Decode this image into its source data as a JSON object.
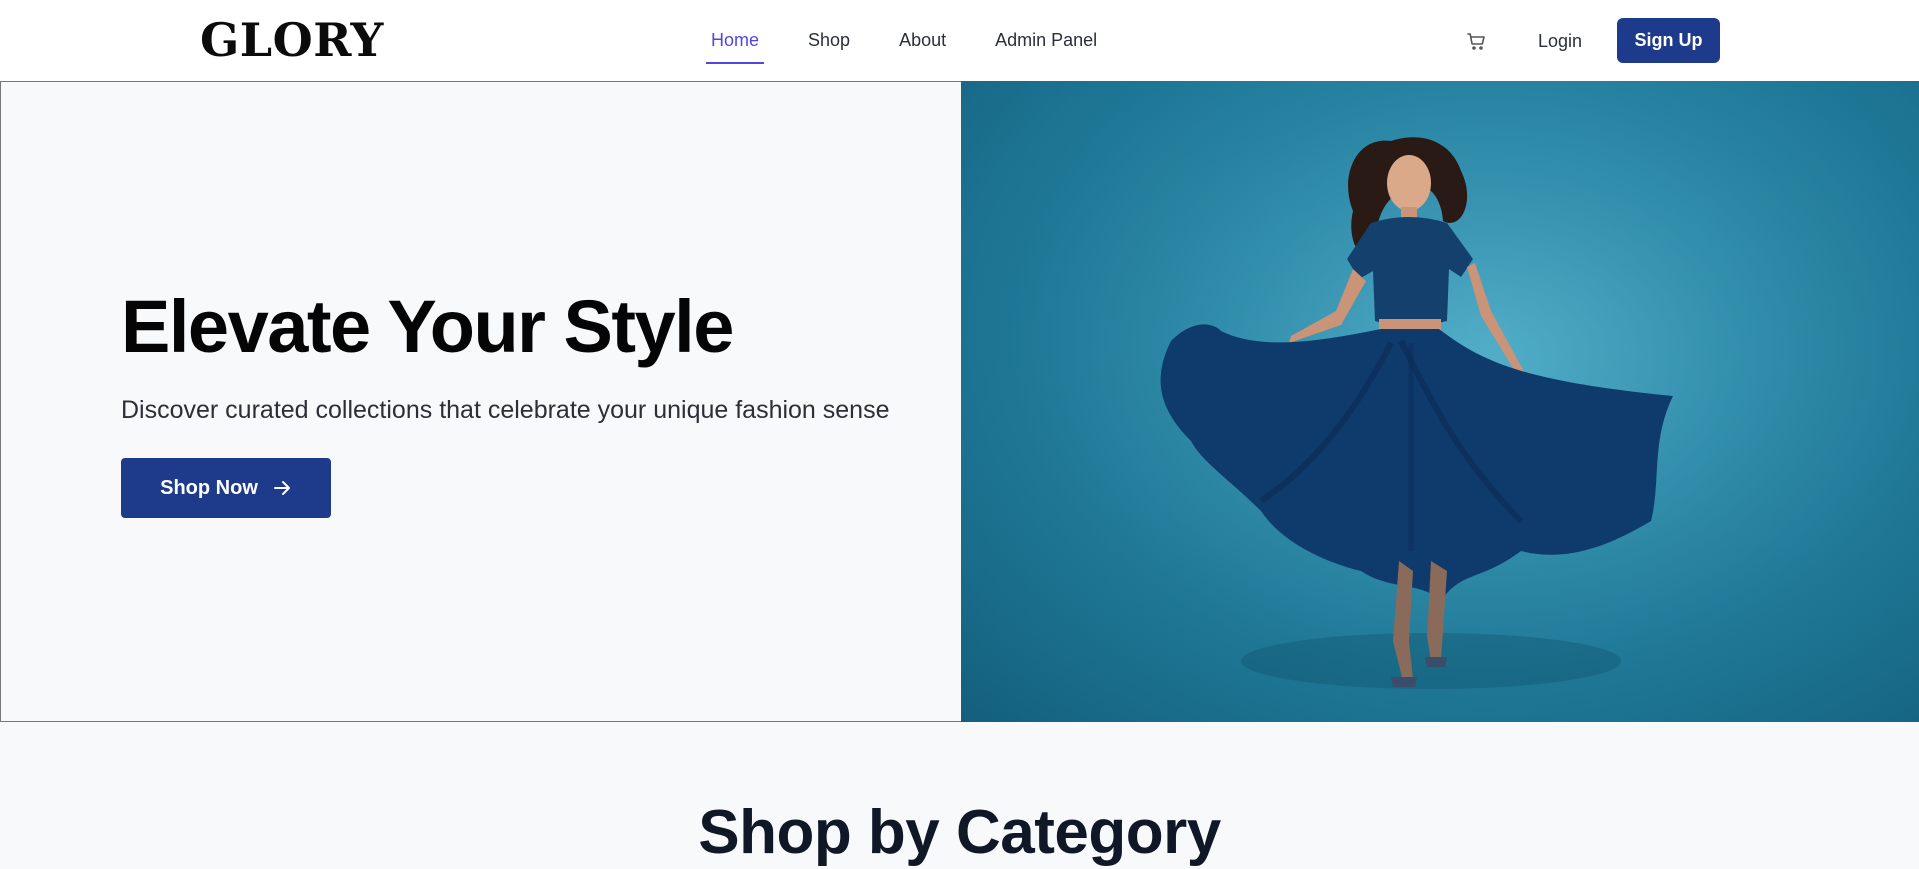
{
  "brand": {
    "logo": "GLORY"
  },
  "nav": {
    "items": [
      {
        "label": "Home",
        "active": true
      },
      {
        "label": "Shop",
        "active": false
      },
      {
        "label": "About",
        "active": false
      },
      {
        "label": "Admin Panel",
        "active": false
      }
    ]
  },
  "header": {
    "cart_icon": "cart-icon",
    "login_label": "Login",
    "signup_label": "Sign Up"
  },
  "hero": {
    "title": "Elevate Your Style",
    "subtitle": "Discover curated collections that celebrate your unique fashion sense",
    "cta_label": "Shop Now",
    "cta_icon": "arrow-right-icon",
    "image_subject": "woman in flowing blue dress on teal background"
  },
  "category": {
    "title": "Shop by Category"
  },
  "colors": {
    "primary": "#1e3a8a",
    "nav_active": "#4f46e5",
    "hero_bg": "#2f8fae",
    "page_bg": "#f8f9fb"
  }
}
